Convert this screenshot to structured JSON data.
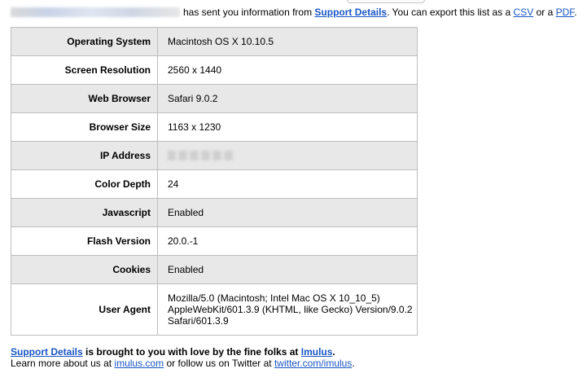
{
  "intro": {
    "after_email": "has sent you information from",
    "app_link": "Support Details",
    "export_text": ". You can export this list as a",
    "csv_link": "CSV",
    "or_text": "or a",
    "pdf_link": "PDF",
    "end_punct": "."
  },
  "details": [
    {
      "label": "Operating System",
      "value": "Macintosh OS X 10.10.5"
    },
    {
      "label": "Screen Resolution",
      "value": "2560 x 1440"
    },
    {
      "label": "Web Browser",
      "value": "Safari 9.0.2"
    },
    {
      "label": "Browser Size",
      "value": "1163 x 1230"
    },
    {
      "label": "IP Address",
      "value": ""
    },
    {
      "label": "Color Depth",
      "value": "24"
    },
    {
      "label": "Javascript",
      "value": "Enabled"
    },
    {
      "label": "Flash Version",
      "value": "20.0.-1"
    },
    {
      "label": "Cookies",
      "value": "Enabled"
    },
    {
      "label": "User Agent",
      "value_lines": [
        "Mozilla/5.0 (Macintosh; Intel Mac OS X 10_10_5)",
        "AppleWebKit/601.3.9 (KHTML, like Gecko) Version/9.0.2",
        "Safari/601.3.9"
      ]
    }
  ],
  "footer": {
    "brand_link": "Support Details",
    "brought_text": "is brought to you with love by the fine folks at",
    "company_link": "Imulus",
    "line1_end": ".",
    "learn_text": "Learn more about us at",
    "site_link": "imulus.com",
    "follow_text": "or follow us on Twitter at",
    "twitter_link": "twitter.com/imulus",
    "line2_end": "."
  }
}
